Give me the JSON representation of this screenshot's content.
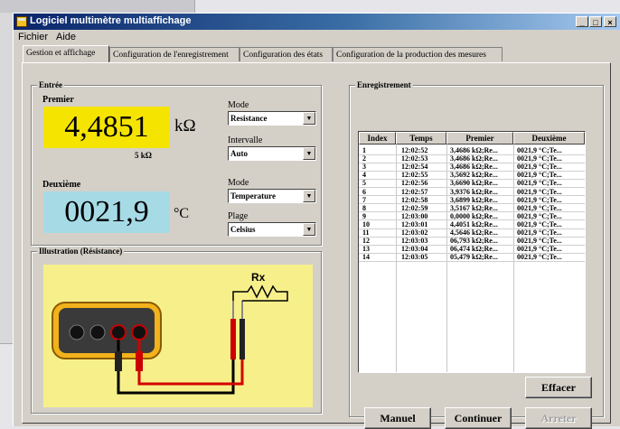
{
  "window": {
    "title": "Logiciel multimètre multiaffichage"
  },
  "menu": {
    "file": "Fichier",
    "help": "Aide"
  },
  "tabs": [
    {
      "label": "Gestion et affichage"
    },
    {
      "label": "Configuration de l'enregistrement"
    },
    {
      "label": "Configuration des états"
    },
    {
      "label": "Configuration de la production des mesures"
    }
  ],
  "entree": {
    "group_label": "Entrée",
    "premier": {
      "label": "Premier",
      "value": "4,4851",
      "unit": "kΩ",
      "range": "5 kΩ"
    },
    "deuxieme": {
      "label": "Deuxième",
      "value": "0021,9",
      "unit": "°C"
    },
    "controls": {
      "mode1_label": "Mode",
      "mode1_value": "Resistance",
      "interval_label": "Intervalle",
      "interval_value": "Auto",
      "mode2_label": "Mode",
      "mode2_value": "Temperature",
      "plage_label": "Plage",
      "plage_value": "Celsius"
    }
  },
  "illustration": {
    "label": "Illustration (Résistance)",
    "resistor_label": "Rx"
  },
  "enregistrement": {
    "group_label": "Enregistrement",
    "columns": [
      "Index",
      "Temps",
      "Premier",
      "Deuxième"
    ],
    "rows": [
      [
        "1",
        "12:02:52",
        "3,4686 kΩ;Re...",
        "0021,9 °C;Te..."
      ],
      [
        "2",
        "12:02:53",
        "3,4686 kΩ;Re...",
        "0021,9 °C;Te..."
      ],
      [
        "3",
        "12:02:54",
        "3,4686 kΩ;Re...",
        "0021,9 °C;Te..."
      ],
      [
        "4",
        "12:02:55",
        "3,5692 kΩ;Re...",
        "0021,9 °C;Te..."
      ],
      [
        "5",
        "12:02:56",
        "3,6690 kΩ;Re...",
        "0021,9 °C;Te..."
      ],
      [
        "6",
        "12:02:57",
        "3,9376 kΩ;Re...",
        "0021,9 °C;Te..."
      ],
      [
        "7",
        "12:02:58",
        "3,6899 kΩ;Re...",
        "0021,9 °C;Te..."
      ],
      [
        "8",
        "12:02:59",
        "3,5167 kΩ;Re...",
        "0021,9 °C;Te..."
      ],
      [
        "9",
        "12:03:00",
        "0,0000 kΩ;Re...",
        "0021,9 °C;Te..."
      ],
      [
        "10",
        "12:03:01",
        "4,4051 kΩ;Re...",
        "0021,9 °C;Te..."
      ],
      [
        "11",
        "12:03:02",
        "4,5646 kΩ;Re...",
        "0021,9 °C;Te..."
      ],
      [
        "12",
        "12:03:03",
        "06,793 kΩ;Re...",
        "0021,9 °C;Te..."
      ],
      [
        "13",
        "12:03:04",
        "06,474 kΩ;Re...",
        "0021,9 °C;Te..."
      ],
      [
        "14",
        "12:03:05",
        "05,479 kΩ;Re...",
        "0021,9 °C;Te..."
      ]
    ]
  },
  "buttons": {
    "effacer": "Effacer",
    "manuel": "Manuel",
    "continuer": "Continuer",
    "arreter": "Arreter"
  },
  "colors": {
    "premier_display": "#f5e400",
    "deuxieme_display": "#a6dbe6",
    "illustration_bg": "#f7f08a"
  }
}
